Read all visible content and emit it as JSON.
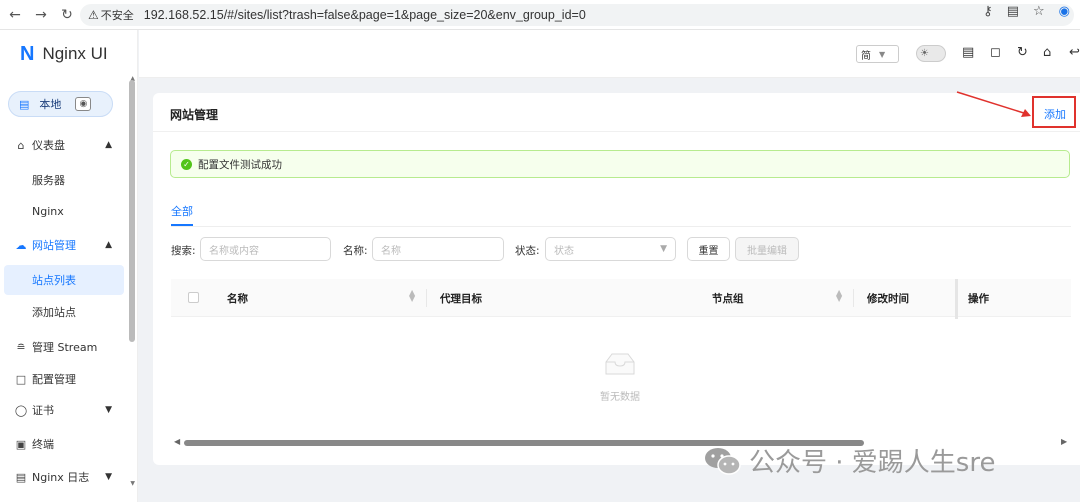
{
  "browser": {
    "back_icon": "back-arrow-icon",
    "forward_icon": "forward-arrow-icon",
    "reload_icon": "reload-icon",
    "security_label": "不安全",
    "url": "192.168.52.15/#/sites/list?trash=false&page=1&page_size=20&env_group_id=0"
  },
  "app": {
    "logo_mark": "N",
    "title": "Nginx UI",
    "env_label": "本地"
  },
  "sidebar": {
    "items": [
      {
        "label": "仪表盘",
        "icon": "home-icon"
      },
      {
        "label": "服务器"
      },
      {
        "label": "Nginx"
      },
      {
        "label": "网站管理",
        "icon": "cloud-icon"
      },
      {
        "label": "站点列表"
      },
      {
        "label": "添加站点"
      },
      {
        "label": "管理 Stream",
        "icon": "share-icon"
      },
      {
        "label": "配置管理",
        "icon": "file-icon"
      },
      {
        "label": "证书",
        "icon": "shield-icon"
      },
      {
        "label": "终端",
        "icon": "terminal-icon"
      },
      {
        "label": "Nginx 日志",
        "icon": "log-icon"
      }
    ]
  },
  "topbar": {
    "lang": "简"
  },
  "page": {
    "title": "网站管理",
    "add_label": "添加",
    "alert": "配置文件测试成功",
    "tab_all": "全部",
    "search_label": "搜索:",
    "search_placeholder": "名称或内容",
    "name_label": "名称:",
    "name_placeholder": "名称",
    "status_label": "状态:",
    "status_placeholder": "状态",
    "reset_label": "重置",
    "batch_label": "批量编辑",
    "columns": [
      "名称",
      "代理目标",
      "节点组",
      "修改时间",
      "操作"
    ],
    "empty_text": "暂无数据"
  },
  "watermark": "公众号 · 爱踢人生sre",
  "colors": {
    "accent": "#1677ff",
    "success": "#52c41a",
    "highlight": "#e0322d"
  }
}
